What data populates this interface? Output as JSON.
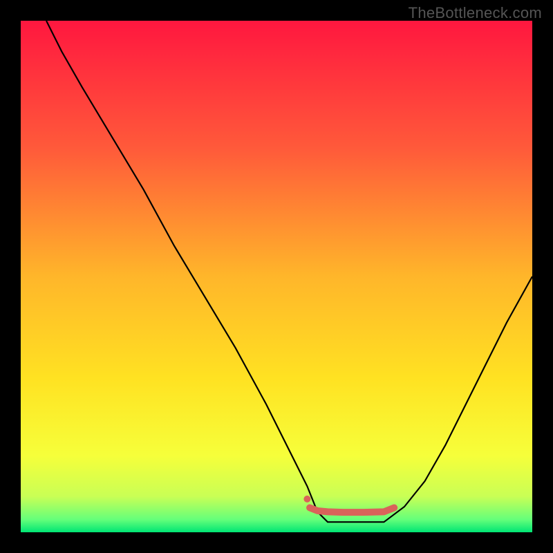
{
  "watermark": "TheBottleneck.com",
  "chart_data": {
    "type": "line",
    "title": "",
    "xlabel": "",
    "ylabel": "",
    "xlim": [
      0,
      100
    ],
    "ylim": [
      0,
      100
    ],
    "grid": false,
    "legend": false,
    "background_gradient_stops": [
      {
        "offset": 0.0,
        "color": "#ff173f"
      },
      {
        "offset": 0.25,
        "color": "#ff5a3a"
      },
      {
        "offset": 0.5,
        "color": "#ffb62a"
      },
      {
        "offset": 0.7,
        "color": "#ffe222"
      },
      {
        "offset": 0.85,
        "color": "#f6ff3a"
      },
      {
        "offset": 0.93,
        "color": "#c9ff55"
      },
      {
        "offset": 0.975,
        "color": "#65ff7a"
      },
      {
        "offset": 1.0,
        "color": "#00e574"
      }
    ],
    "series": [
      {
        "name": "curve",
        "color": "#000000",
        "stroke_width": 2.2,
        "x": [
          5,
          8,
          12,
          18,
          24,
          30,
          36,
          42,
          48,
          53,
          56,
          58,
          60,
          63,
          67,
          71,
          75,
          79,
          83,
          87,
          91,
          95,
          100
        ],
        "y": [
          100,
          94,
          87,
          77,
          67,
          56,
          46,
          36,
          25,
          15,
          9,
          4,
          2,
          2,
          2,
          2,
          5,
          10,
          17,
          25,
          33,
          41,
          50
        ]
      },
      {
        "name": "flat-marker",
        "color": "#d9635a",
        "stroke_width": 10,
        "linecap": "round",
        "x": [
          56.5,
          58,
          60,
          63,
          67,
          71,
          73
        ],
        "y": [
          4.8,
          4.2,
          4.0,
          3.9,
          3.9,
          4.0,
          4.8
        ]
      }
    ],
    "annotations": [
      {
        "name": "marker-dot-left",
        "x": 56,
        "y": 6.5,
        "color": "#d9635a",
        "radius": 5
      }
    ]
  }
}
